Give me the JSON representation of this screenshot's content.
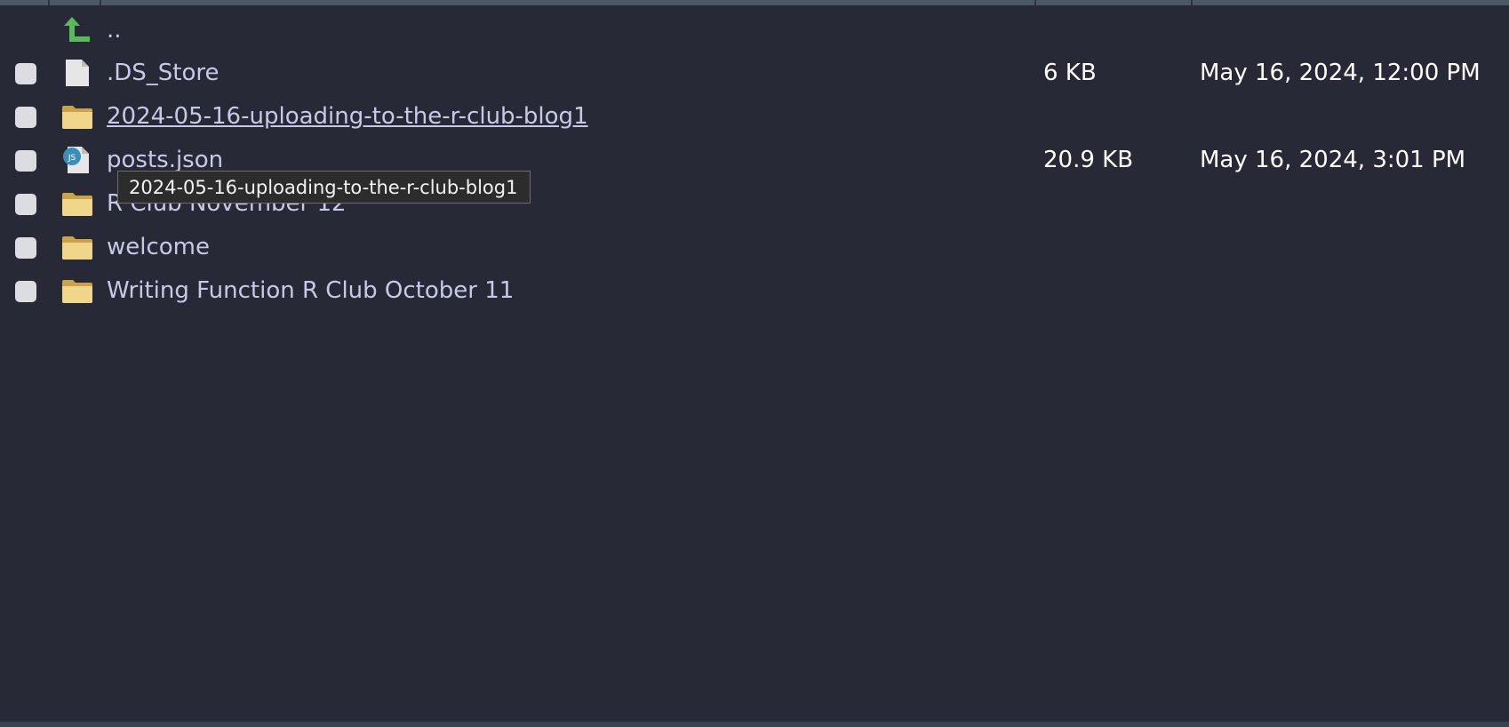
{
  "files": {
    "parent": {
      "label": "..",
      "icon": "up-arrow-icon"
    },
    "rows": [
      {
        "name": ".DS_Store",
        "size": "6 KB",
        "modified": "May 16, 2024, 12:00 PM",
        "icon": "file-icon"
      },
      {
        "name": "2024-05-16-uploading-to-the-r-club-blog1",
        "size": "",
        "modified": "",
        "icon": "folder-icon"
      },
      {
        "name": "posts.json",
        "size": "20.9 KB",
        "modified": "May 16, 2024, 3:01 PM",
        "icon": "json-file-icon"
      },
      {
        "name": "R Club November 12",
        "size": "",
        "modified": "",
        "icon": "folder-icon"
      },
      {
        "name": "welcome",
        "size": "",
        "modified": "",
        "icon": "folder-icon"
      },
      {
        "name": "Writing Function R Club October 11",
        "size": "",
        "modified": "",
        "icon": "folder-icon"
      }
    ]
  },
  "tooltip": {
    "text": "2024-05-16-uploading-to-the-r-club-blog1"
  },
  "colors": {
    "background": "#272a36",
    "name_text": "#c7c9e6",
    "meta_text": "#ffffff",
    "folder": "#e8c46e",
    "up_arrow": "#5cb85c"
  }
}
